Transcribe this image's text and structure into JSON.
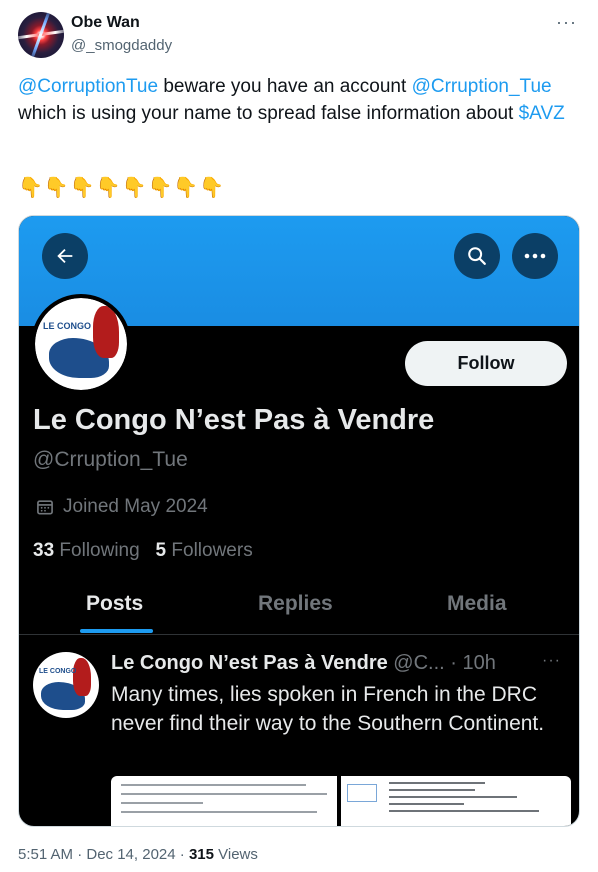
{
  "tweet": {
    "author_name": "Obe Wan",
    "author_handle": "@_smogdaddy",
    "more_glyph": "···",
    "text_parts": [
      "@CorruptionTue",
      " beware you have an account ",
      "@Crruption_Tue",
      " which is using your name to spread false information about ",
      "$AVZ"
    ],
    "emojis": "👇👇👇👇👇👇👇👇",
    "time": "5:51 AM · Dec 14, 2024 ·",
    "views_count": "315",
    "views_label": "Views"
  },
  "screenshot": {
    "follow_label": "Follow",
    "avatar_text": "LE CONGO N'EST PAS À VENDRE",
    "profile_name": "Le Congo N’est Pas à Vendre",
    "profile_handle": "@Crruption_Tue",
    "joined": "Joined May 2024",
    "following_count": "33",
    "following_label": "Following",
    "followers_count": "5",
    "followers_label": "Followers",
    "tabs": [
      "Posts",
      "Replies",
      "Media"
    ],
    "post": {
      "name": "Le Congo N’est Pas à Vendre",
      "meta": " @C... · 10h",
      "more_glyph": "···",
      "text": "Many times, lies spoken in French in the DRC never find their way to the Southern Continent."
    }
  },
  "colors": {
    "link": "#1d9bf0",
    "banner": "#1d9bf0",
    "dark_bg": "#000000"
  }
}
